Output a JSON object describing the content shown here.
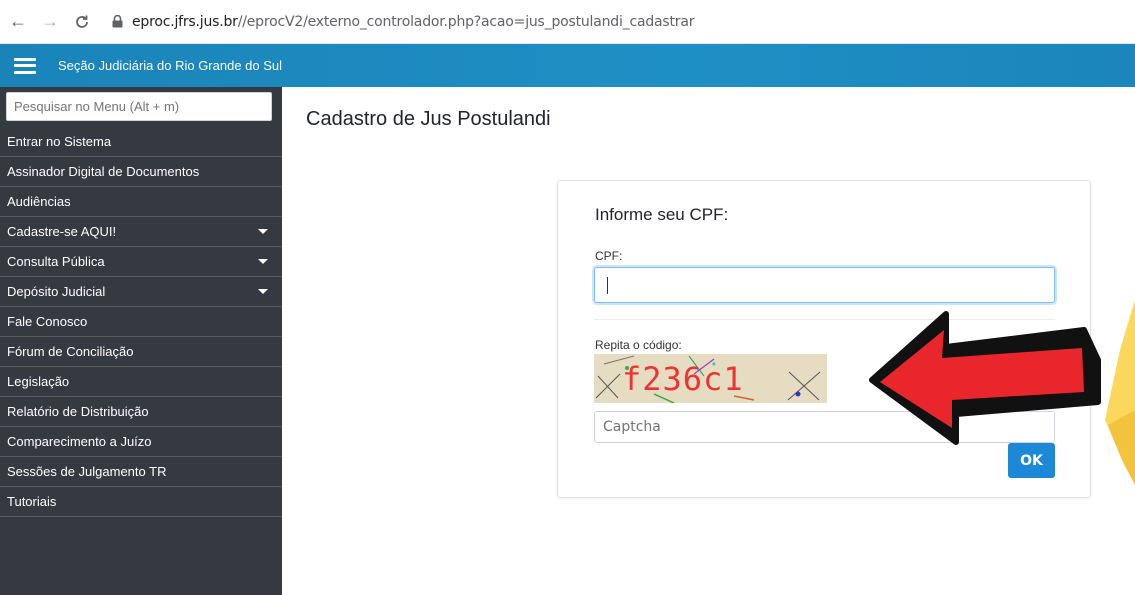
{
  "browser": {
    "url_host": "eproc.jfrs.jus.br",
    "url_path": "//eprocV2/externo_controlador.php?acao=jus_postulandi_cadastrar",
    "icons": [
      "back-icon",
      "forward-icon",
      "reload-icon",
      "lock-icon"
    ]
  },
  "header": {
    "title": "Seção Judiciária do Rio Grande do Sul",
    "bg_color": "#1e8fc4"
  },
  "sidebar": {
    "search_placeholder": "Pesquisar no Menu (Alt + m)",
    "items": [
      {
        "label": "Entrar no Sistema",
        "has_submenu": false
      },
      {
        "label": "Assinador Digital de Documentos",
        "has_submenu": false
      },
      {
        "label": "Audiências",
        "has_submenu": false
      },
      {
        "label": "Cadastre-se AQUI!",
        "has_submenu": true
      },
      {
        "label": "Consulta Pública",
        "has_submenu": true
      },
      {
        "label": "Depósito Judicial",
        "has_submenu": true
      },
      {
        "label": "Fale Conosco",
        "has_submenu": false
      },
      {
        "label": "Fórum de Conciliação",
        "has_submenu": false
      },
      {
        "label": "Legislação",
        "has_submenu": false
      },
      {
        "label": "Relatório de Distribuição",
        "has_submenu": false
      },
      {
        "label": "Comparecimento a Juízo",
        "has_submenu": false
      },
      {
        "label": "Sessões de Julgamento TR",
        "has_submenu": false
      },
      {
        "label": "Tutoriais",
        "has_submenu": false
      }
    ],
    "bg_color": "#343a40"
  },
  "main": {
    "page_title": "Cadastro de Jus Postulandi",
    "form": {
      "title": "Informe seu CPF:",
      "cpf_label": "CPF:",
      "cpf_value": "",
      "captcha_label": "Repita o código:",
      "captcha_text": "f236c1",
      "captcha_placeholder": "Captcha",
      "ok_label": "OK",
      "ok_color": "#1e88d8"
    }
  },
  "annotation": {
    "arrow_color": "#e8262b",
    "arrow_outline": "#111111"
  }
}
